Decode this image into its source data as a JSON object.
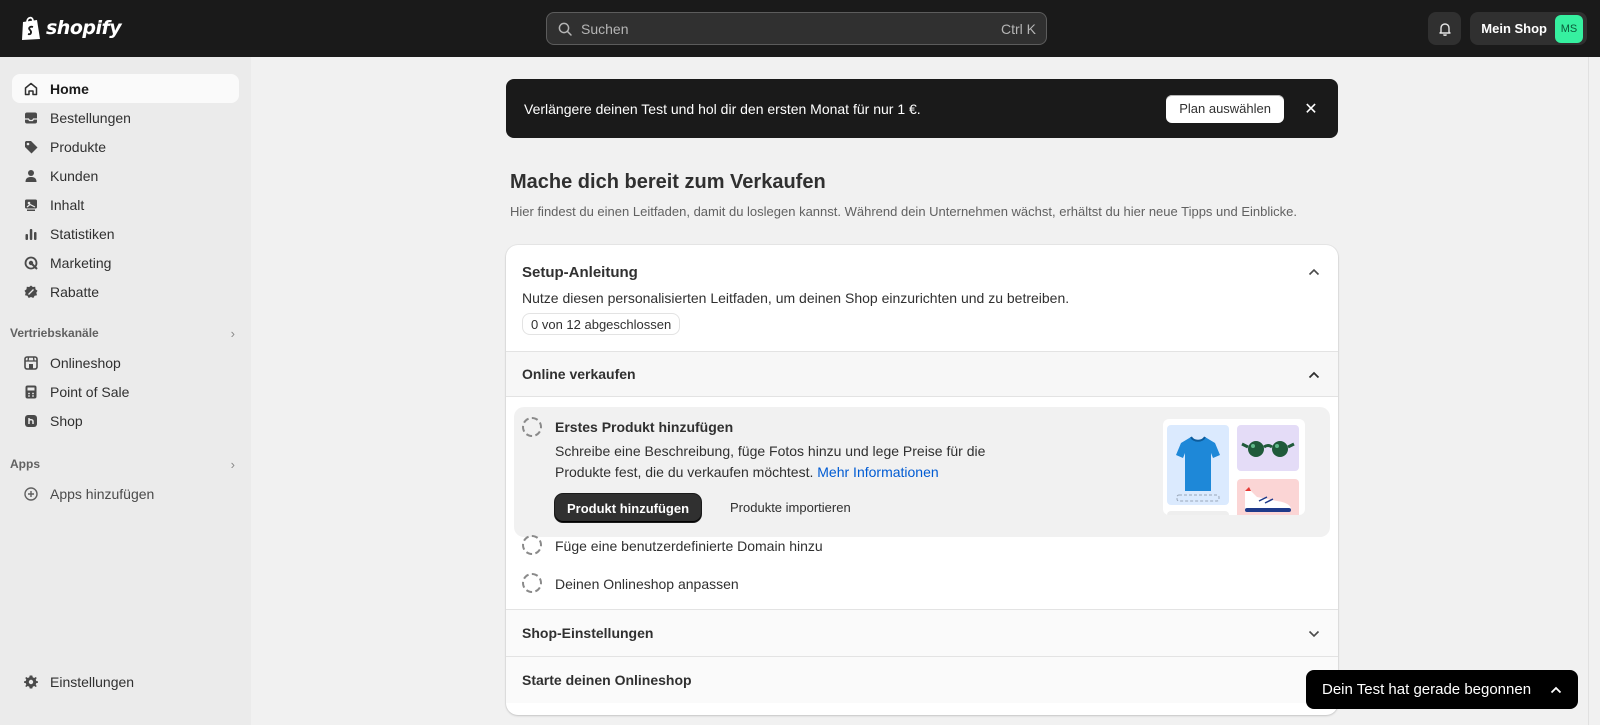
{
  "app": {
    "brand": "shopify"
  },
  "search": {
    "placeholder": "Suchen",
    "shortcut": "Ctrl K"
  },
  "store": {
    "name": "Mein Shop",
    "initials": "MS"
  },
  "sidebar": {
    "items": [
      {
        "label": "Home",
        "icon": "home-icon",
        "active": true
      },
      {
        "label": "Bestellungen",
        "icon": "inbox-icon"
      },
      {
        "label": "Produkte",
        "icon": "tag-icon"
      },
      {
        "label": "Kunden",
        "icon": "person-icon"
      },
      {
        "label": "Inhalt",
        "icon": "content-icon"
      },
      {
        "label": "Statistiken",
        "icon": "bar-chart-icon"
      },
      {
        "label": "Marketing",
        "icon": "target-icon"
      },
      {
        "label": "Rabatte",
        "icon": "discount-icon"
      }
    ],
    "sales_channels": {
      "title": "Vertriebskanäle",
      "items": [
        {
          "label": "Onlineshop",
          "icon": "storefront-icon"
        },
        {
          "label": "Point of Sale",
          "icon": "pos-icon"
        },
        {
          "label": "Shop",
          "icon": "shop-app-icon"
        }
      ]
    },
    "apps": {
      "title": "Apps",
      "add_label": "Apps hinzufügen"
    },
    "settings_label": "Einstellungen"
  },
  "banner": {
    "text": "Verlängere deinen Test und hol dir den ersten Monat für nur 1 €.",
    "button": "Plan auswählen",
    "close": "✕"
  },
  "main": {
    "title": "Mache dich bereit zum Verkaufen",
    "subtitle": "Hier findest du einen Leitfaden, damit du loslegen kannst. Während dein Unternehmen wächst, erhältst du hier neue Tipps und Einblicke."
  },
  "setup": {
    "title": "Setup-Anleitung",
    "description": "Nutze diesen personalisierten Leitfaden, um deinen Shop einzurichten und zu betreiben.",
    "progress": "0 von 12 abgeschlossen",
    "completed": 0,
    "total": 12,
    "sections": [
      {
        "title": "Online verkaufen",
        "expanded": true
      },
      {
        "title": "Shop-Einstellungen",
        "expanded": false
      },
      {
        "title": "Starte deinen Onlineshop",
        "expanded": false
      }
    ],
    "active_task": {
      "title": "Erstes Produkt hinzufügen",
      "body": "Schreibe eine Beschreibung, füge Fotos hinzu und lege Preise für die Produkte fest, die du verkaufen möchtest.",
      "link": "Mehr Informationen",
      "primary_button": "Produkt hinzufügen",
      "secondary_button": "Produkte importieren"
    },
    "other_tasks": [
      "Füge eine benutzerdefinierte Domain hinzu",
      "Deinen Onlineshop anpassen"
    ]
  },
  "toast": {
    "text": "Dein Test hat gerade begonnen"
  },
  "colors": {
    "topbar": "#1a1a1a",
    "avatar": "#36f0a0",
    "link": "#005bd3",
    "sidebar": "#ebebeb"
  }
}
